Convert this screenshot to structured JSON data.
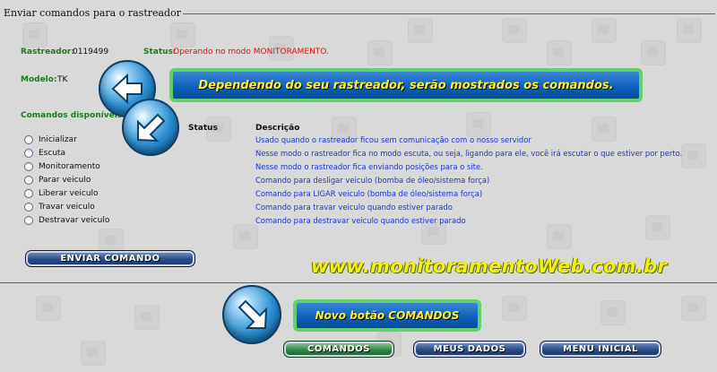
{
  "legend": "Enviar comandos para o rastreador",
  "info": {
    "rastreador_label": "Rastreador:",
    "rastreador_value": "0119499",
    "status_label": "Status:",
    "status_value": "Operando no modo MONITORAMENTO.",
    "modelo_label": "Modelo:",
    "modelo_value": "TK"
  },
  "commands_label": "Comandos disponíveis:",
  "headers": {
    "status": "Status",
    "descricao": "Descrição"
  },
  "commands": [
    {
      "name": "Inicializar",
      "desc": "Usado quando o rastreador ficou sem comunicação com o nosso servidor"
    },
    {
      "name": "Escuta",
      "desc": "Nesse modo o rastreador fica no modo escuta, ou seja, ligando para ele, você irá escutar o que estiver por perto."
    },
    {
      "name": "Monitoramento",
      "desc": "Nesse modo o rastreador fica enviando posições para o site."
    },
    {
      "name": "Parar veiculo",
      "desc": "Comando para desligar veiculo (bomba de óleo/sistema força)"
    },
    {
      "name": "Liberar veiculo",
      "desc": "Comando para LIGAR veiculo (bomba de óleo/sistema força)"
    },
    {
      "name": "Travar veiculo",
      "desc": "Comando para travar veiculo quando estiver parado"
    },
    {
      "name": "Destravar veiculo",
      "desc": "Comando para destravar veiculo quando estiver parado"
    }
  ],
  "buttons": {
    "enviar": "ENVIAR COMANDO",
    "comandos": "COMANDOS",
    "meus_dados": "MEUS DADOS",
    "menu_inicial": "MENU INICIAL"
  },
  "annotations": {
    "callout_top": "Dependendo do seu rastreador,  serão mostrados os comandos.",
    "website": "www.monitoramentoWeb.com.br",
    "callout_bottom": "Novo botão COMANDOS"
  }
}
